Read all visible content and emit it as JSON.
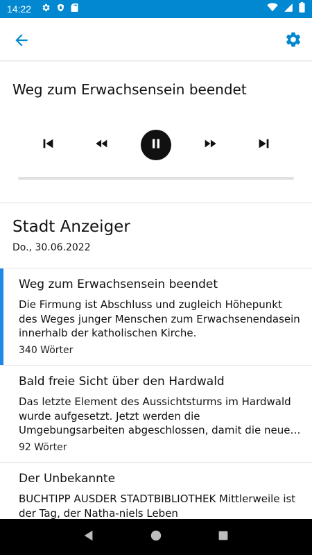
{
  "status_bar": {
    "time": "14:22",
    "left_icons": [
      "gear-icon",
      "shield-icon",
      "sd-card-icon"
    ],
    "right_icons": [
      "wifi-icon",
      "signal-icon",
      "battery-icon"
    ]
  },
  "app_bar": {
    "accent_color": "#0288d1"
  },
  "player": {
    "title": "Weg zum Erwachsensein beendet",
    "state": "playing",
    "progress": 0.0
  },
  "newspaper": {
    "name": "Stadt Anzeiger",
    "date": "Do., 30.06.2022"
  },
  "articles": [
    {
      "title": "Weg zum Erwachsensein beendet",
      "body": "Die Firmung ist Abschluss und zugleich Höhepunkt des Weges junger Menschen zum Erwachsenendasein innerhalb der katholischen Kirche.",
      "words": "340 Wörter",
      "active": true
    },
    {
      "title": "Bald freie Sicht über den Hardwald",
      "body": "Das letzte Element des Aussichtsturms im Hardwald wurde aufgesetzt. Jetzt werden die Umgebungsarbeiten abgeschlossen, damit die neue Anlage bald eröffnet werden kann.",
      "words": "92 Wörter",
      "active": false
    },
    {
      "title": "Der Unbekannte",
      "body": "BUCHTIPP AUSDER STADTBIBLIOTHEK Mittlerweile ist der Tag, der Natha-niels Leben",
      "words": "",
      "active": false
    }
  ],
  "colors": {
    "accent": "#0288d1",
    "active_indicator": "#1e88e5"
  }
}
